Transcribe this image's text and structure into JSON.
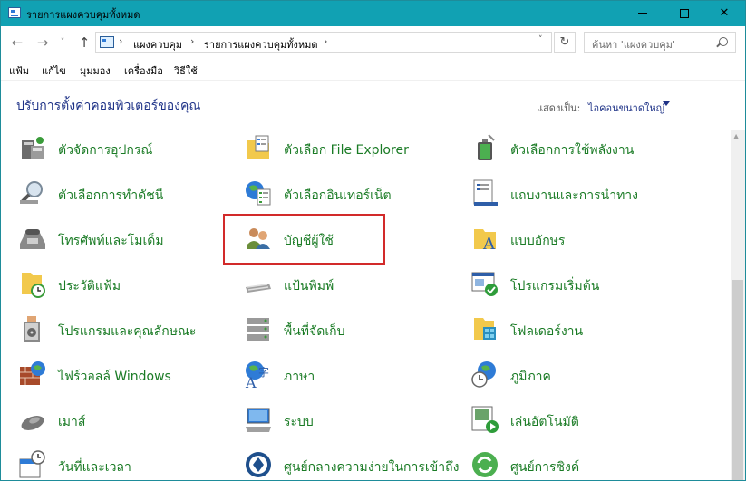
{
  "window": {
    "title": "รายการแผงควบคุมทั้งหมด"
  },
  "nav": {
    "back": "←",
    "forward": "→",
    "recent": "˅",
    "up": "↑",
    "refresh": "↻"
  },
  "address": {
    "crumbs": [
      "แผงควบคุม",
      "รายการแผงควบคุมทั้งหมด"
    ],
    "separator": "›",
    "dropdown": "˅"
  },
  "search": {
    "placeholder": "ค้นหา 'แผงควบคุม'"
  },
  "menu": [
    "แฟ้ม",
    "แก้ไข",
    "มุมมอง",
    "เครื่องมือ",
    "วิธีใช้"
  ],
  "header": {
    "title": "ปรับการตั้งค่าคอมพิวเตอร์ของคุณ",
    "view_label": "แสดงเป็น:",
    "view_value": "ไอคอนขนาดใหญ่"
  },
  "items": [
    {
      "label": "ตัวจัดการอุปกรณ์",
      "icon": "device-manager-icon"
    },
    {
      "label": "ตัวเลือก File Explorer",
      "icon": "file-explorer-options-icon"
    },
    {
      "label": "ตัวเลือกการใช้พลังงาน",
      "icon": "power-options-icon"
    },
    {
      "label": "ตัวเลือกการทำดัชนี",
      "icon": "indexing-options-icon"
    },
    {
      "label": "ตัวเลือกอินเทอร์เน็ต",
      "icon": "internet-options-icon"
    },
    {
      "label": "แถบงานและการนำทาง",
      "icon": "taskbar-navigation-icon"
    },
    {
      "label": "โทรศัพท์และโมเด็ม",
      "icon": "phone-modem-icon"
    },
    {
      "label": "บัญชีผู้ใช้",
      "icon": "user-accounts-icon"
    },
    {
      "label": "แบบอักษร",
      "icon": "fonts-icon"
    },
    {
      "label": "ประวัติแฟ้ม",
      "icon": "file-history-icon"
    },
    {
      "label": "แป้นพิมพ์",
      "icon": "keyboard-icon"
    },
    {
      "label": "โปรแกรมเริ่มต้น",
      "icon": "default-programs-icon"
    },
    {
      "label": "โปรแกรมและคุณลักษณะ",
      "icon": "programs-features-icon"
    },
    {
      "label": "พื้นที่จัดเก็บ",
      "icon": "storage-spaces-icon"
    },
    {
      "label": "โฟลเดอร์งาน",
      "icon": "work-folders-icon"
    },
    {
      "label": "ไฟร์วอลล์ Windows",
      "icon": "windows-firewall-icon"
    },
    {
      "label": "ภาษา",
      "icon": "language-icon"
    },
    {
      "label": "ภูมิภาค",
      "icon": "region-icon"
    },
    {
      "label": "เมาส์",
      "icon": "mouse-icon"
    },
    {
      "label": "ระบบ",
      "icon": "system-icon"
    },
    {
      "label": "เล่นอัตโนมัติ",
      "icon": "autoplay-icon"
    },
    {
      "label": "วันที่และเวลา",
      "icon": "date-time-icon"
    },
    {
      "label": "ศูนย์กลางความง่ายในการเข้าถึง",
      "icon": "ease-of-access-icon"
    },
    {
      "label": "ศูนย์การซิงค์",
      "icon": "sync-center-icon"
    }
  ],
  "colors": {
    "titlebar": "#11a1b3",
    "link": "#1a7b25",
    "heading": "#1e3287",
    "highlight": "#d22a2a"
  }
}
